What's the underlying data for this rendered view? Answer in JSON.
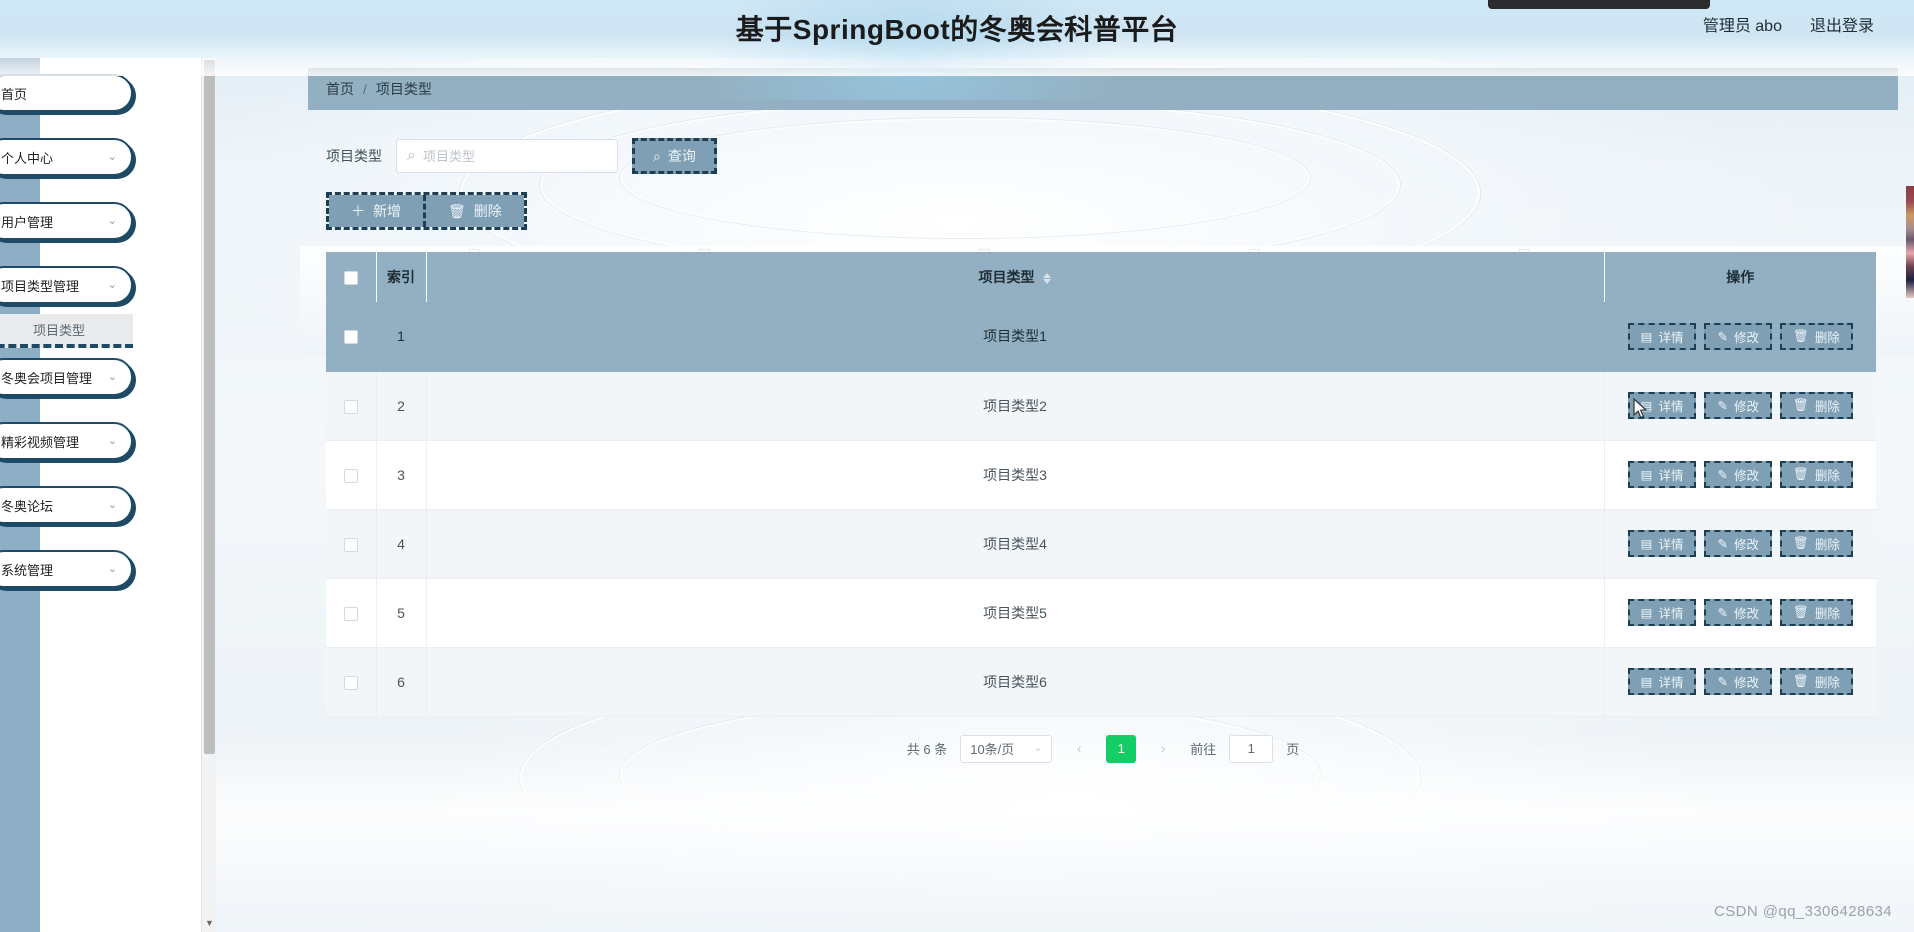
{
  "header": {
    "title": "基于SpringBoot的冬奥会科普平台",
    "user_label": "管理员 abo",
    "logout_label": "退出登录"
  },
  "sidebar": {
    "items": [
      {
        "label": "首页",
        "has_caret": false
      },
      {
        "label": "个人中心",
        "has_caret": true
      },
      {
        "label": "用户管理",
        "has_caret": true
      },
      {
        "label": "项目类型管理",
        "has_caret": true
      },
      {
        "label": "冬奥会项目管理",
        "has_caret": true
      },
      {
        "label": "精彩视频管理",
        "has_caret": true
      },
      {
        "label": "冬奥论坛",
        "has_caret": true
      },
      {
        "label": "系统管理",
        "has_caret": true
      }
    ],
    "submenu": {
      "label": "项目类型",
      "parent_index": 3
    },
    "caret_glyph": "⌄"
  },
  "breadcrumb": {
    "home": "首页",
    "separator": "/",
    "current": "项目类型"
  },
  "filter": {
    "label": "项目类型",
    "placeholder": "项目类型",
    "value": "",
    "query_button": "查询",
    "search_glyph": "⌕"
  },
  "toolbar": {
    "add_label": "新增",
    "add_glyph": "＋",
    "delete_label": "删除",
    "delete_glyph": "🗑"
  },
  "table": {
    "columns": {
      "index": "索引",
      "type": "项目类型",
      "actions": "操作"
    },
    "rows": [
      {
        "index": "1",
        "type": "项目类型1"
      },
      {
        "index": "2",
        "type": "项目类型2"
      },
      {
        "index": "3",
        "type": "项目类型3"
      },
      {
        "index": "4",
        "type": "项目类型4"
      },
      {
        "index": "5",
        "type": "项目类型5"
      },
      {
        "index": "6",
        "type": "项目类型6"
      }
    ],
    "row_actions": {
      "detail": "详情",
      "detail_glyph": "▤",
      "edit": "修改",
      "edit_glyph": "✎",
      "delete": "删除",
      "delete_glyph": "🗑"
    }
  },
  "pagination": {
    "total_text": "共 6 条",
    "page_size": "10条/页",
    "prev_glyph": "‹",
    "next_glyph": "›",
    "current_page": "1",
    "jump_prefix": "前往",
    "jump_value": "1",
    "jump_suffix": "页"
  },
  "watermark": "CSDN @qq_3306428634",
  "colors": {
    "header_bg": "#cfe5f3",
    "sidebar_bg": "#8daec4",
    "panel_accent": "#93b0c2",
    "button_bg": "#7e9fb4",
    "dashed_border": "#1d3f54",
    "pager_active": "#13ce66"
  }
}
